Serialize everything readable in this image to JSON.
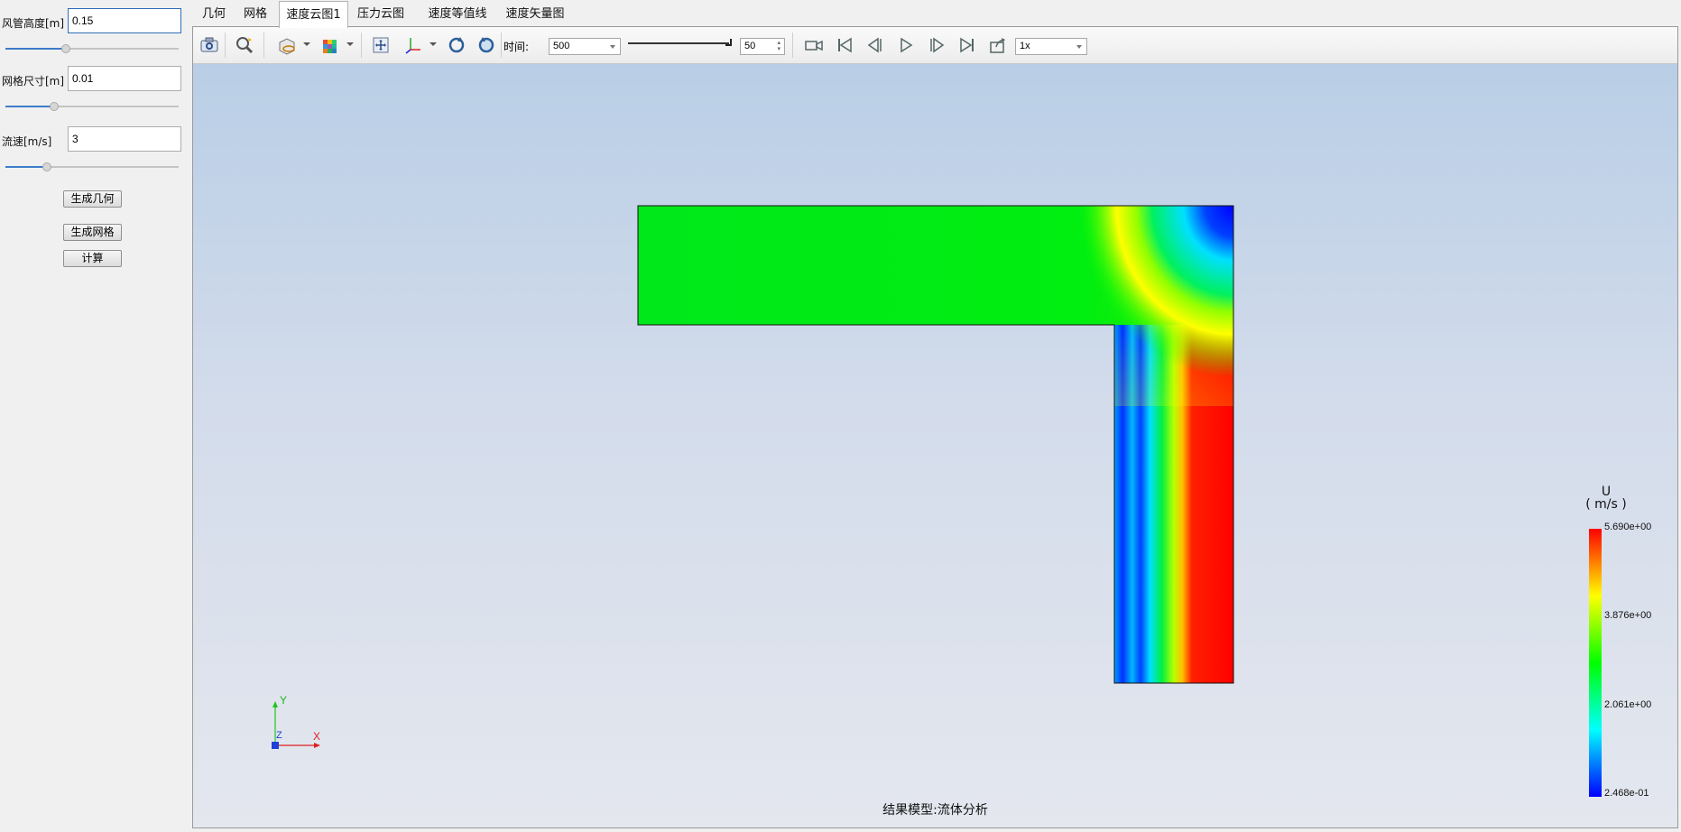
{
  "left_panel": {
    "duct_height": {
      "label": "风管高度[m]",
      "value": "0.15",
      "slider": 0.35
    },
    "mesh_size": {
      "label": "网格尺寸[m]",
      "value": "0.01",
      "slider": 0.28
    },
    "velocity": {
      "label": "流速[m/s]",
      "value": "3",
      "slider": 0.24
    },
    "buttons": {
      "generate_geometry": "生成几何",
      "generate_mesh": "生成网格",
      "compute": "计算"
    }
  },
  "tabs": [
    {
      "label": "几何",
      "active": false
    },
    {
      "label": "网格",
      "active": false
    },
    {
      "label": "速度云图1",
      "active": true
    },
    {
      "label": "压力云图",
      "active": false
    },
    {
      "label": "速度等值线",
      "active": false
    },
    {
      "label": "速度矢量图",
      "active": false
    }
  ],
  "toolbar": {
    "icons": [
      "camera-icon",
      "zoom-icon",
      "display-mode-icon",
      "color-cube-icon",
      "fit-view-icon",
      "axes-view-icon",
      "rotate-ccw-icon",
      "rotate-cw-icon"
    ],
    "time_label": "时间:",
    "time_value": "500",
    "frame_value": "50",
    "playback_icons": [
      "record-icon",
      "first-frame-icon",
      "prev-frame-icon",
      "play-icon",
      "next-frame-icon",
      "last-frame-icon",
      "export-icon"
    ],
    "speed_value": "1x"
  },
  "viewport": {
    "status": "结果模型:流体分析",
    "axes": {
      "y": "Y",
      "z": "Z",
      "x": "X"
    },
    "legend": {
      "variable": "U",
      "unit": "( m/s )",
      "ticks": [
        "5.690e+00",
        "3.876e+00",
        "2.061e+00",
        "2.468e-01"
      ]
    },
    "colors": {
      "bg_top": "#b9cee6",
      "bg_bottom": "#e4e7ee",
      "low": "#0000ff",
      "mid": "#00ff00",
      "high": "#ff0000"
    }
  }
}
